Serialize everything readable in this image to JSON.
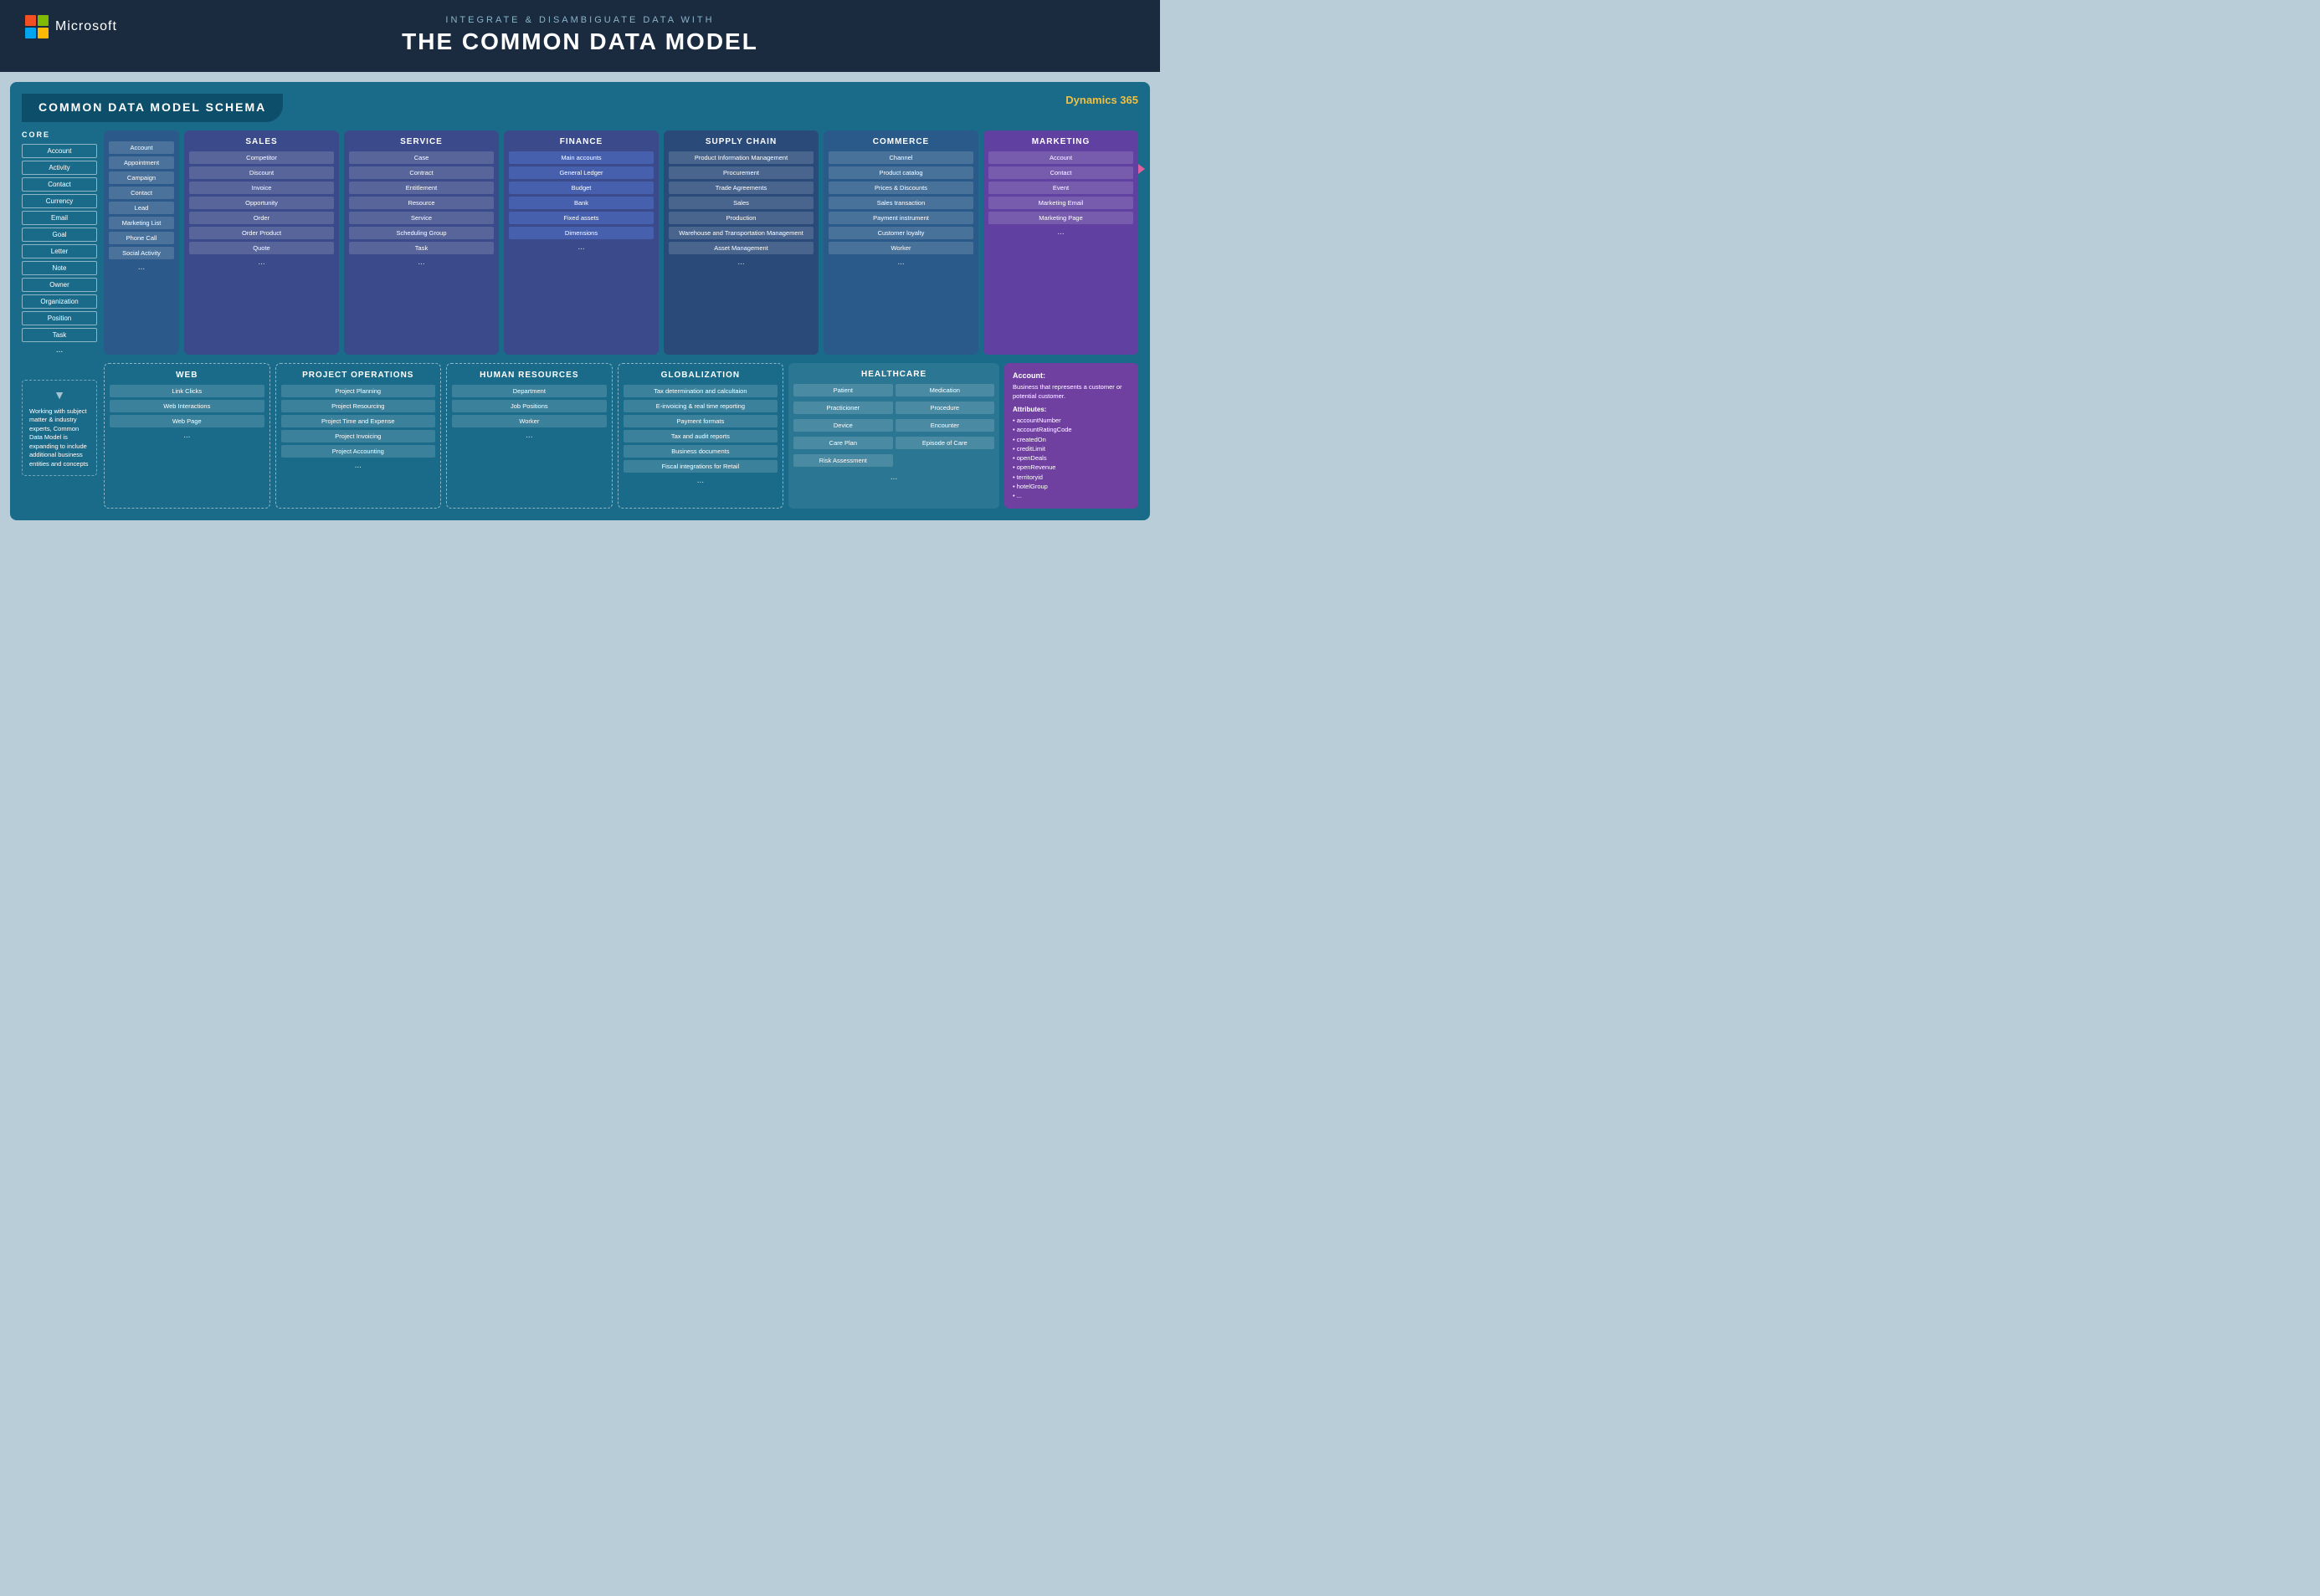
{
  "header": {
    "subtitle": "INTEGRATE & DISAMBIGUATE DATA WITH",
    "title": "THE COMMON DATA MODEL",
    "logo_text": "Microsoft"
  },
  "schema": {
    "title": "COMMON DATA MODEL SCHEMA",
    "dynamics_label": "Dynamics 365"
  },
  "core": {
    "label": "CORE",
    "items": [
      "Account",
      "Activity",
      "Contact",
      "Currency",
      "Email",
      "Goal",
      "Letter",
      "Note",
      "Owner",
      "Organization",
      "Position",
      "Task"
    ],
    "dots": "..."
  },
  "generic_col": {
    "items": [
      "Account",
      "Appointment",
      "Campaign",
      "Contact",
      "Lead",
      "Marketing List",
      "Phone Call",
      "Social Activity"
    ],
    "dots": "..."
  },
  "categories": {
    "sales": {
      "title": "SALES",
      "items": [
        "Competitor",
        "Discount",
        "Invoice",
        "Opportunity",
        "Order",
        "Order Product",
        "Quote"
      ],
      "dots": "..."
    },
    "service": {
      "title": "SERVICE",
      "items": [
        "Case",
        "Contract",
        "Entitlement",
        "Resource",
        "Service",
        "Scheduling Group",
        "Task"
      ],
      "dots": "..."
    },
    "finance": {
      "title": "FINANCE",
      "items": [
        "Main accounts",
        "General Ledger",
        "Budget",
        "Bank",
        "Fixed assets",
        "Dimensions"
      ],
      "dots": "..."
    },
    "supply_chain": {
      "title": "SUPPLY CHAIN",
      "items": [
        "Product Information Management",
        "Procurement",
        "Trade Agreements",
        "Sales",
        "Production",
        "Warehouse and Transportation Management",
        "Asset Management"
      ],
      "dots": "..."
    },
    "commerce": {
      "title": "COMMERCE",
      "items": [
        "Channel",
        "Product catalog",
        "Prices & Discounts",
        "Sales transaction",
        "Payment instrument",
        "Customer loyalty",
        "Worker"
      ],
      "dots": "..."
    },
    "marketing": {
      "title": "MARKETING",
      "items": [
        "Account",
        "Contact",
        "Event",
        "Marketing Email",
        "Marketing Page"
      ],
      "dots": "..."
    }
  },
  "bottom": {
    "web": {
      "title": "WEB",
      "items": [
        "Link Clicks",
        "Web Interactions",
        "Web Page"
      ],
      "dots": "..."
    },
    "project_ops": {
      "title": "PROJECT OPERATIONS",
      "items": [
        "Project Planning",
        "Project Resourcing",
        "Project Time and Expense",
        "Project Invoicing",
        "Project Accounting"
      ],
      "dots": "..."
    },
    "human_resources": {
      "title": "HUMAN RESOURCES",
      "items": [
        "Department",
        "Job Positions",
        "Worker"
      ],
      "dots": "..."
    },
    "globalization": {
      "title": "GLOBALIZATION",
      "items": [
        "Tax determination and calcultaion",
        "E-invoicing & real time reporting",
        "Payment formats",
        "Tax and audit reports",
        "Business documents",
        "Fiscal integrations for Retail"
      ],
      "dots": "..."
    },
    "healthcare": {
      "title": "HEALTHCARE",
      "items_left": [
        "Patient",
        "Practicioner",
        "Device",
        "Care Plan",
        "Risk Assessment"
      ],
      "items_right": [
        "Medication",
        "Procedure",
        "Encounter",
        "Episode of Care"
      ],
      "dots": "..."
    }
  },
  "left_text": "Working with subject matter & industry experts, Common Data Model is expanding to include additional business entities and concepts",
  "account_info": {
    "title": "Account:",
    "description": "Business that represents a customer or potential customer.",
    "attrs_title": "Attributes:",
    "attrs": [
      "accountNumber",
      "accountRatingCode",
      "createdOn",
      "creditLimit",
      "openDeals",
      "openRevenue",
      "territoryid",
      "hotelGroup",
      "..."
    ]
  }
}
